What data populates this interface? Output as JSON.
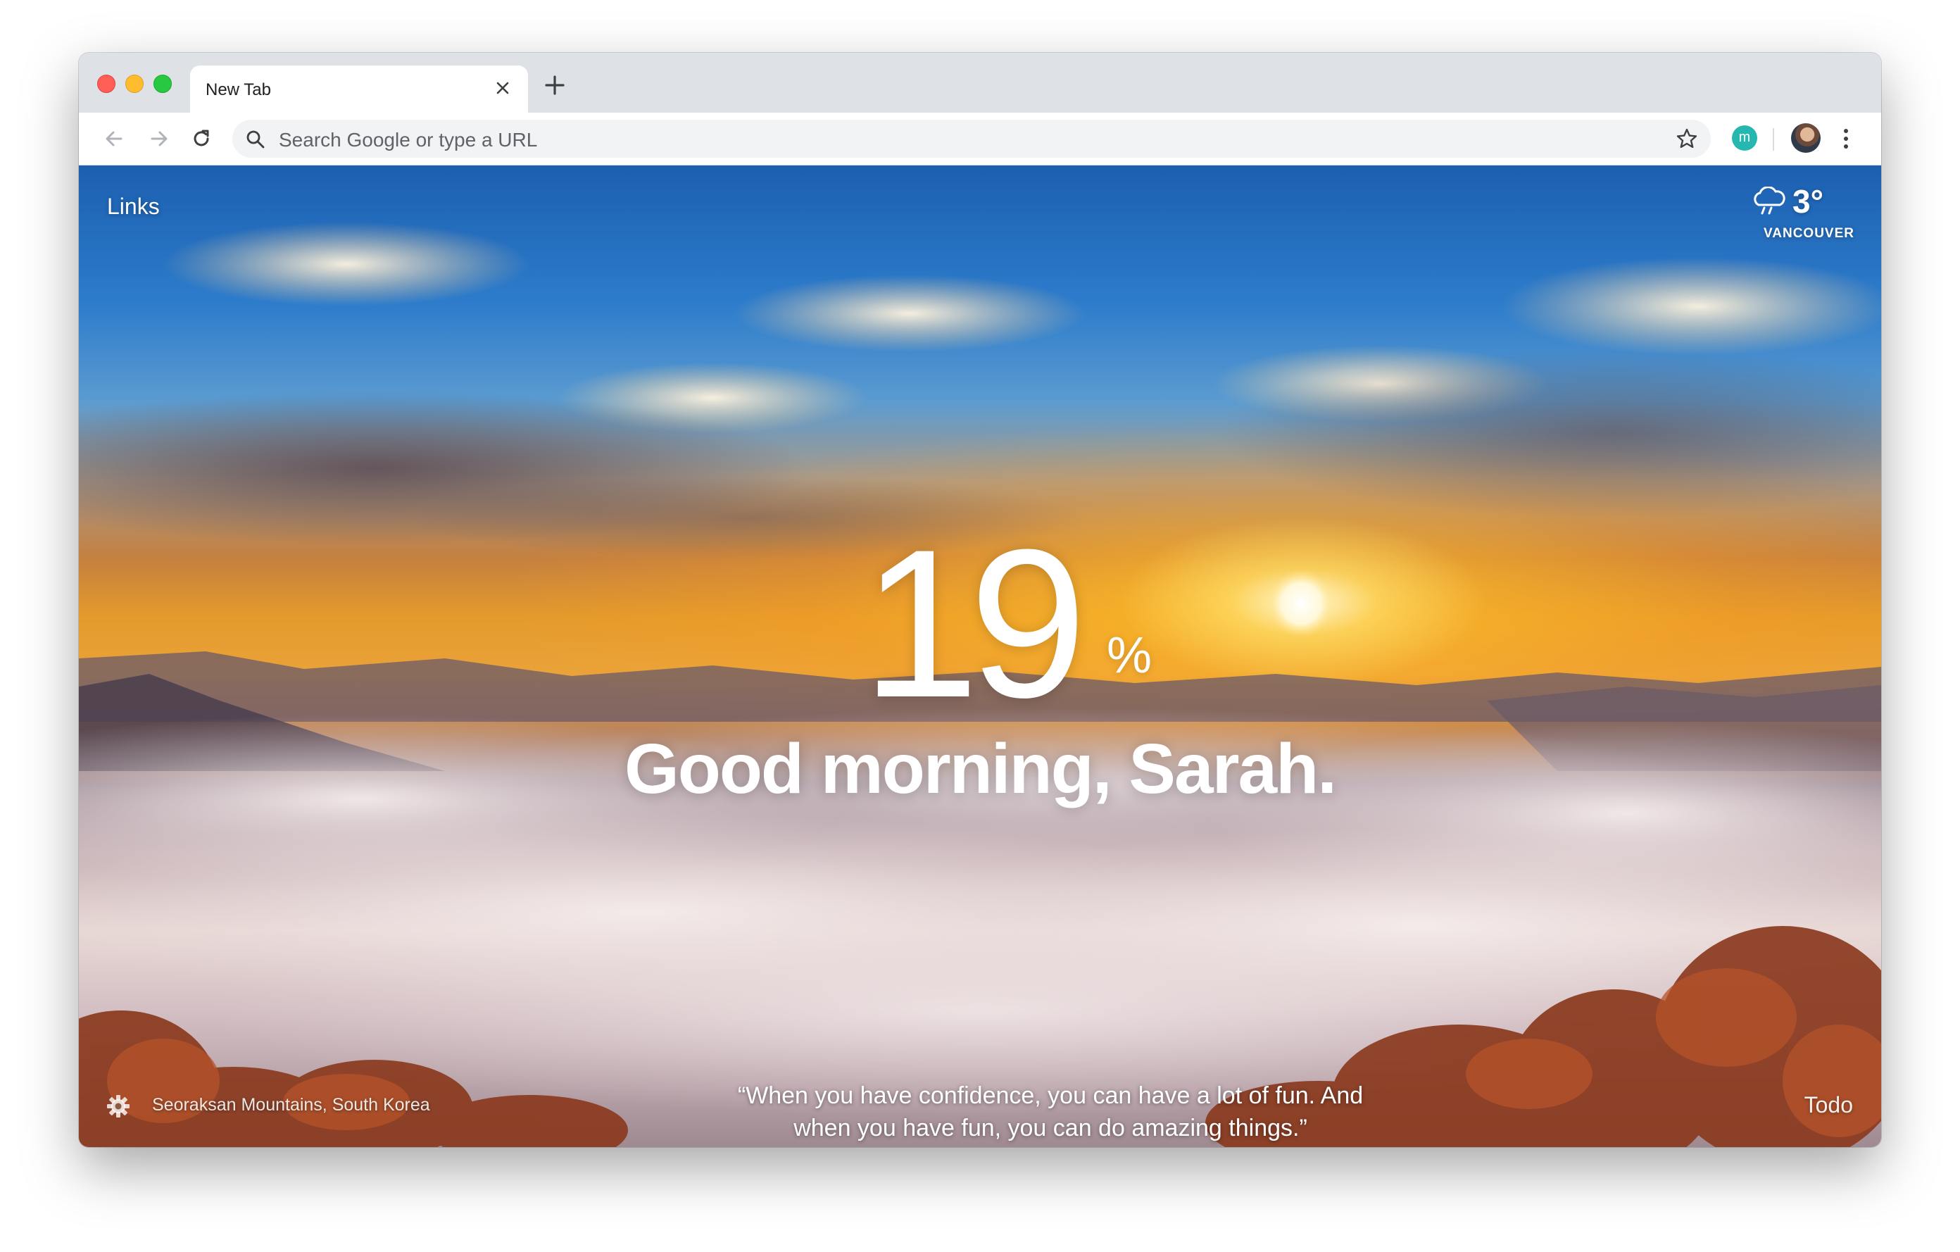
{
  "browser": {
    "tab_title": "New Tab",
    "tab_close_icon": "close-icon",
    "new_tab_icon": "plus-icon",
    "omnibox_placeholder": "Search Google or type a URL",
    "extension_letter": "m"
  },
  "dashboard": {
    "links_label": "Links",
    "weather": {
      "temperature": "3°",
      "location": "VANCOUVER",
      "icon": "cloud-rain-icon"
    },
    "focus_number": "19",
    "focus_unit": "%",
    "greeting": "Good morning, Sarah.",
    "photo_credit": "Seoraksan Mountains, South Korea",
    "quote_line1": "“When you have confidence, you can have a lot of fun. And",
    "quote_line2": "when you have fun, you can do amazing things.”",
    "todo_label": "Todo"
  },
  "colors": {
    "traffic_red": "#ff5f57",
    "traffic_yellow": "#febc2e",
    "traffic_green": "#28c840",
    "extension_teal": "#26b8b0"
  }
}
